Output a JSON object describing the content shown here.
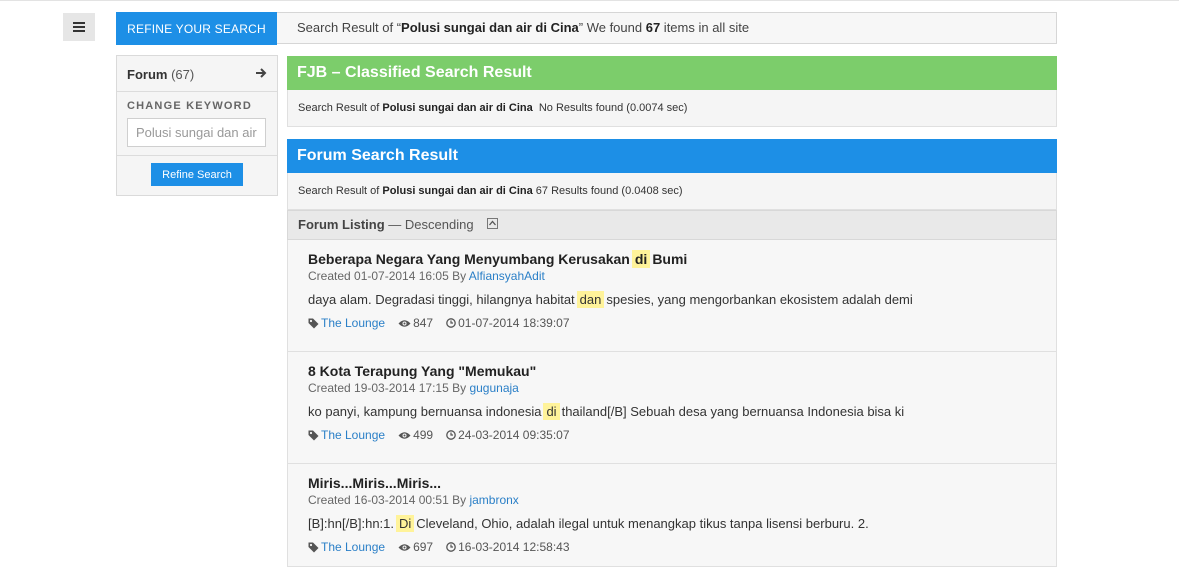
{
  "menu": {
    "icon": "hamburger-icon"
  },
  "topbar": {
    "tab_label": "REFINE YOUR SEARCH",
    "prefix": "Search Result of “",
    "query": "Polusi sungai dan air di Cina",
    "mid": "” We found ",
    "count": "67",
    "suffix": " items in all site"
  },
  "sidebar": {
    "forum_label": "Forum",
    "forum_count": "(67)",
    "arrow_icon": "arrow-right-icon",
    "keyword_title": "CHANGE KEYWORD",
    "keyword_placeholder": "Polusi sungai dan air",
    "refine_button": "Refine Search"
  },
  "fjb": {
    "title": "FJB – Classified Search Result",
    "prefix": "Search Result of ",
    "query": "Polusi sungai dan air di Cina",
    "result_text": "No Results found (0.0074 sec)"
  },
  "forum": {
    "title": "Forum Search Result",
    "prefix": "Search Result of ",
    "query": "Polusi sungai dan air di Cina",
    "result_text": "67 Results found (0.0408 sec)",
    "listing_label": "Forum Listing",
    "listing_sort": "— Descending"
  },
  "results": [
    {
      "title_before": "Beberapa Negara Yang Menyumbang Kerusakan",
      "title_hl": "di",
      "title_after": "Bumi",
      "created": "Created 01-07-2014 16:05 By",
      "author": "AlfiansyahAdit",
      "snip_before": "daya alam. Degradasi tinggi, hilangnya habitat",
      "snip_hl": "dan",
      "snip_after": "spesies, yang mengorbankan ekosistem adalah demi",
      "category": "The Lounge",
      "views": "847",
      "last": "01-07-2014 18:39:07"
    },
    {
      "title_before": "8 Kota Terapung Yang \"Memukau\"",
      "title_hl": "",
      "title_after": "",
      "created": "Created 19-03-2014 17:15 By",
      "author": "gugunaja",
      "snip_before": "ko panyi, kampung bernuansa indonesia",
      "snip_hl": "di",
      "snip_after": "thailand[/B] Sebuah desa yang bernuansa Indonesia bisa ki",
      "category": "The Lounge",
      "views": "499",
      "last": "24-03-2014 09:35:07"
    },
    {
      "title_before": "Miris...Miris...Miris...",
      "title_hl": "",
      "title_after": "",
      "created": "Created 16-03-2014 00:51 By",
      "author": "jambronx",
      "snip_before": "[B]:hn[/B]:hn:1.",
      "snip_hl": "Di",
      "snip_after": "Cleveland, Ohio, adalah ilegal untuk menangkap tikus tanpa lisensi berburu. 2.",
      "category": "The Lounge",
      "views": "697",
      "last": "16-03-2014 12:58:43"
    }
  ],
  "colors": {
    "accent_blue": "#1d8fe6",
    "fjb_green": "#7ccd6b",
    "highlight": "#fff39a",
    "link": "#2a7fc7"
  },
  "icons": [
    "tag-icon",
    "eye-icon",
    "clock-icon",
    "sort-toggle-icon"
  ]
}
